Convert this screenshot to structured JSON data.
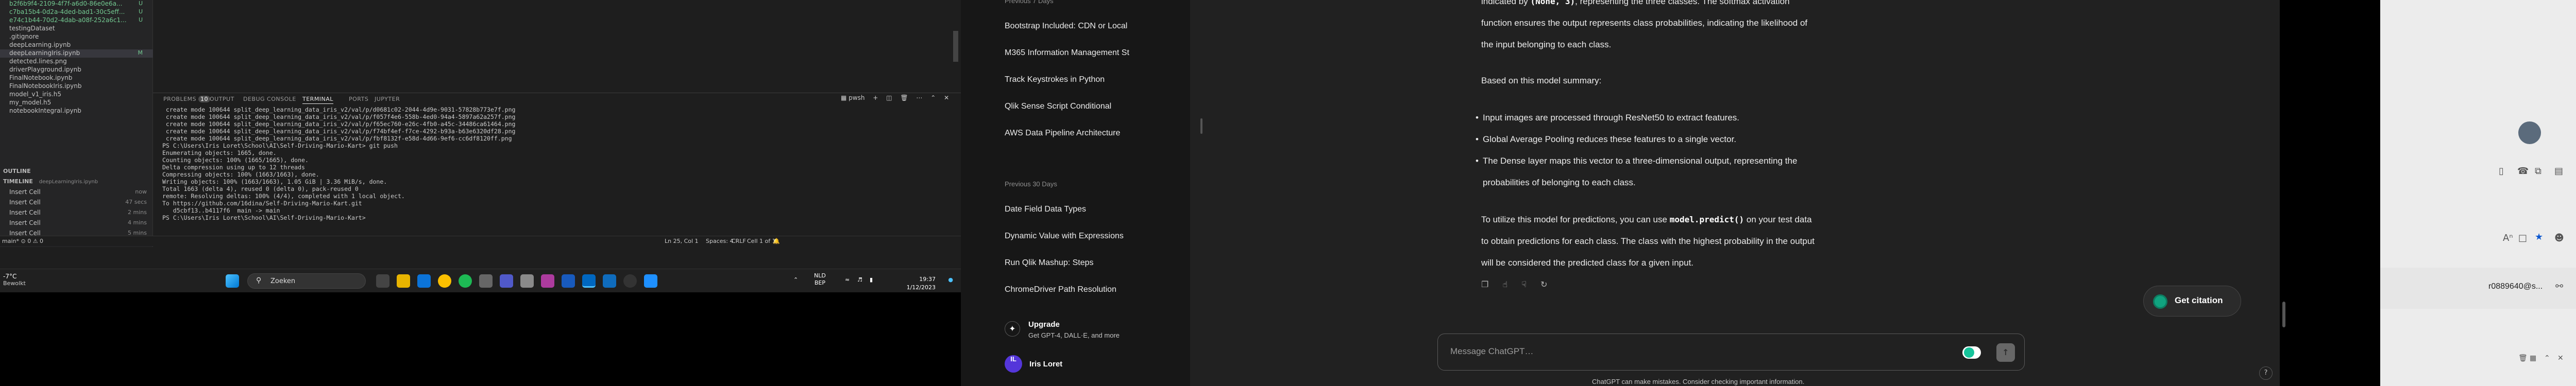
{
  "vscode": {
    "explorer_items": [
      {
        "label": "b2f6b9f4-2109-4f7f-a6d0-86e0e6a...",
        "badge": "U"
      },
      {
        "label": "c7ba15b4-0d2a-4ded-bad1-30c5eff...",
        "badge": "U"
      },
      {
        "label": "e74c1b44-70d2-4dab-a08f-252a6c1...",
        "badge": "U"
      },
      {
        "label": "testingDataset",
        "badge": ""
      },
      {
        "label": ".gitignore",
        "badge": ""
      },
      {
        "label": "deepLearning.ipynb",
        "badge": ""
      },
      {
        "label": "deepLearningIris.ipynb",
        "badge": "M"
      },
      {
        "label": "detected.lines.png",
        "badge": ""
      },
      {
        "label": "driverPlayground.ipynb",
        "badge": ""
      },
      {
        "label": "FinalNotebook.ipynb",
        "badge": ""
      },
      {
        "label": "FinalNotebookIris.ipynb",
        "badge": ""
      },
      {
        "label": "model_v1_iris.h5",
        "badge": ""
      },
      {
        "label": "my_model.h5",
        "badge": ""
      },
      {
        "label": "notebookIntegral.ipynb",
        "badge": ""
      }
    ],
    "outline_label": "OUTLINE",
    "timeline_label": "TIMELINE",
    "timeline_file": "deepLearningIris.ipynb",
    "timeline_items": [
      {
        "label": "Insert Cell",
        "time": "now"
      },
      {
        "label": "Insert Cell",
        "time": "47 secs"
      },
      {
        "label": "Insert Cell",
        "time": "2 mins"
      },
      {
        "label": "Insert Cell",
        "time": "4 mins"
      },
      {
        "label": "Insert Cell",
        "time": "5 mins"
      },
      {
        "label": "Insert Cell",
        "time": "6 mins"
      }
    ],
    "terminal_tabs": [
      {
        "label": "PROBLEMS",
        "count": "10"
      },
      {
        "label": "OUTPUT",
        "count": ""
      },
      {
        "label": "DEBUG CONSOLE",
        "count": ""
      },
      {
        "label": "TERMINAL",
        "count": ""
      },
      {
        "label": "PORTS",
        "count": ""
      },
      {
        "label": "JUPYTER",
        "count": ""
      }
    ],
    "terminal_shell": "pwsh",
    "terminal_lines": [
      " create mode 100644 split_deep_learning_data_iris_v2/val/p/d0681c02-2044-4d9e-9031-57828b773e7f.png",
      " create mode 100644 split_deep_learning_data_iris_v2/val/p/f057f4e6-558b-4ed0-94a4-5897a62a257f.png",
      " create mode 100644 split_deep_learning_data_iris_v2/val/p/f65ec760-e26c-4fb0-a45c-34486ca61464.png",
      " create mode 100644 split_deep_learning_data_iris_v2/val/p/f74bf4ef-f7ce-4292-b93a-b63e6320df28.png",
      " create mode 100644 split_deep_learning_data_iris_v2/val/p/fbf8132f-e58d-4d66-9ef6-cc6df8120ff.png",
      "PS C:\\Users\\Iris Loret\\School\\AI\\Self-Driving-Mario-Kart> git push",
      "Enumerating objects: 1665, done.",
      "Counting objects: 100% (1665/1665), done.",
      "Delta compression using up to 12 threads",
      "Compressing objects: 100% (1663/1663), done.",
      "Writing objects: 100% (1663/1663), 1.05 GiB | 3.36 MiB/s, done.",
      "Total 1663 (delta 4), reused 0 (delta 0), pack-reused 0",
      "remote: Resolving deltas: 100% (4/4), completed with 1 local object.",
      "To https://github.com/16dina/Self-Driving-Mario-Kart.git",
      "   d5cbf13..b4117f6  main -> main",
      "PS C:\\Users\\Iris Loret\\School\\AI\\Self-Driving-Mario-Kart> "
    ],
    "status": {
      "left": "main*  ⊙ 0 ⚠ 0",
      "position": "Ln 25, Col 1",
      "spaces": "Spaces: 4",
      "crlf": "CRLF",
      "cell": "Cell 1 of 1"
    },
    "weather": {
      "temp": "-7°C",
      "desc": "Bewolkt"
    }
  },
  "taskbar": {
    "search_placeholder": "Zoeken",
    "lang": "NLD",
    "lang_sub": "BEP",
    "time": "19:37",
    "date": "1/12/2023"
  },
  "chatgpt": {
    "section_top": "Previous 7 Days",
    "history_7": [
      "Bootstrap Included: CDN or Local",
      "M365 Information Management St",
      "Track Keystrokes in Python",
      "Qlik Sense Script Conditional",
      "AWS Data Pipeline Architecture"
    ],
    "section_30": "Previous 30 Days",
    "history_30": [
      "Date Field Data Types",
      "Dynamic Value with Expressions",
      "Run Qlik Mashup: Steps",
      "ChromeDriver Path Resolution"
    ],
    "upgrade_title": "Upgrade",
    "upgrade_sub": "Get GPT-4, DALL·E, and more",
    "user_initials": "IL",
    "user_name": "Iris Loret",
    "para1_a": "indicated by ",
    "para1_code": "(None, 3)",
    "para1_b": ", representing the three classes. The softmax activation",
    "para1_line2": "function ensures the output represents class probabilities, indicating the likelihood of",
    "para1_line3": "the input belonging to each class.",
    "para2": "Based on this model summary:",
    "bullets": [
      "Input images are processed through ResNet50 to extract features.",
      "Global Average Pooling reduces these features to a single vector.",
      "The Dense layer maps this vector to a three-dimensional output, representing the",
      "probabilities of belonging to each class."
    ],
    "para3_a": "To utilize this model for predictions, you can use ",
    "para3_code": "model.predict()",
    "para3_b": " on your test data",
    "para3_line2": "to obtain predictions for each class. The class with the highest probability in the output",
    "para3_line3": "will be considered the predicted class for a given input.",
    "citation_label": "Get citation",
    "composer_placeholder": "Message ChatGPT…",
    "disclaimer": "ChatGPT can make mistakes. Consider checking important information.",
    "help": "?"
  },
  "right_window": {
    "email": "r0889640@s..."
  }
}
